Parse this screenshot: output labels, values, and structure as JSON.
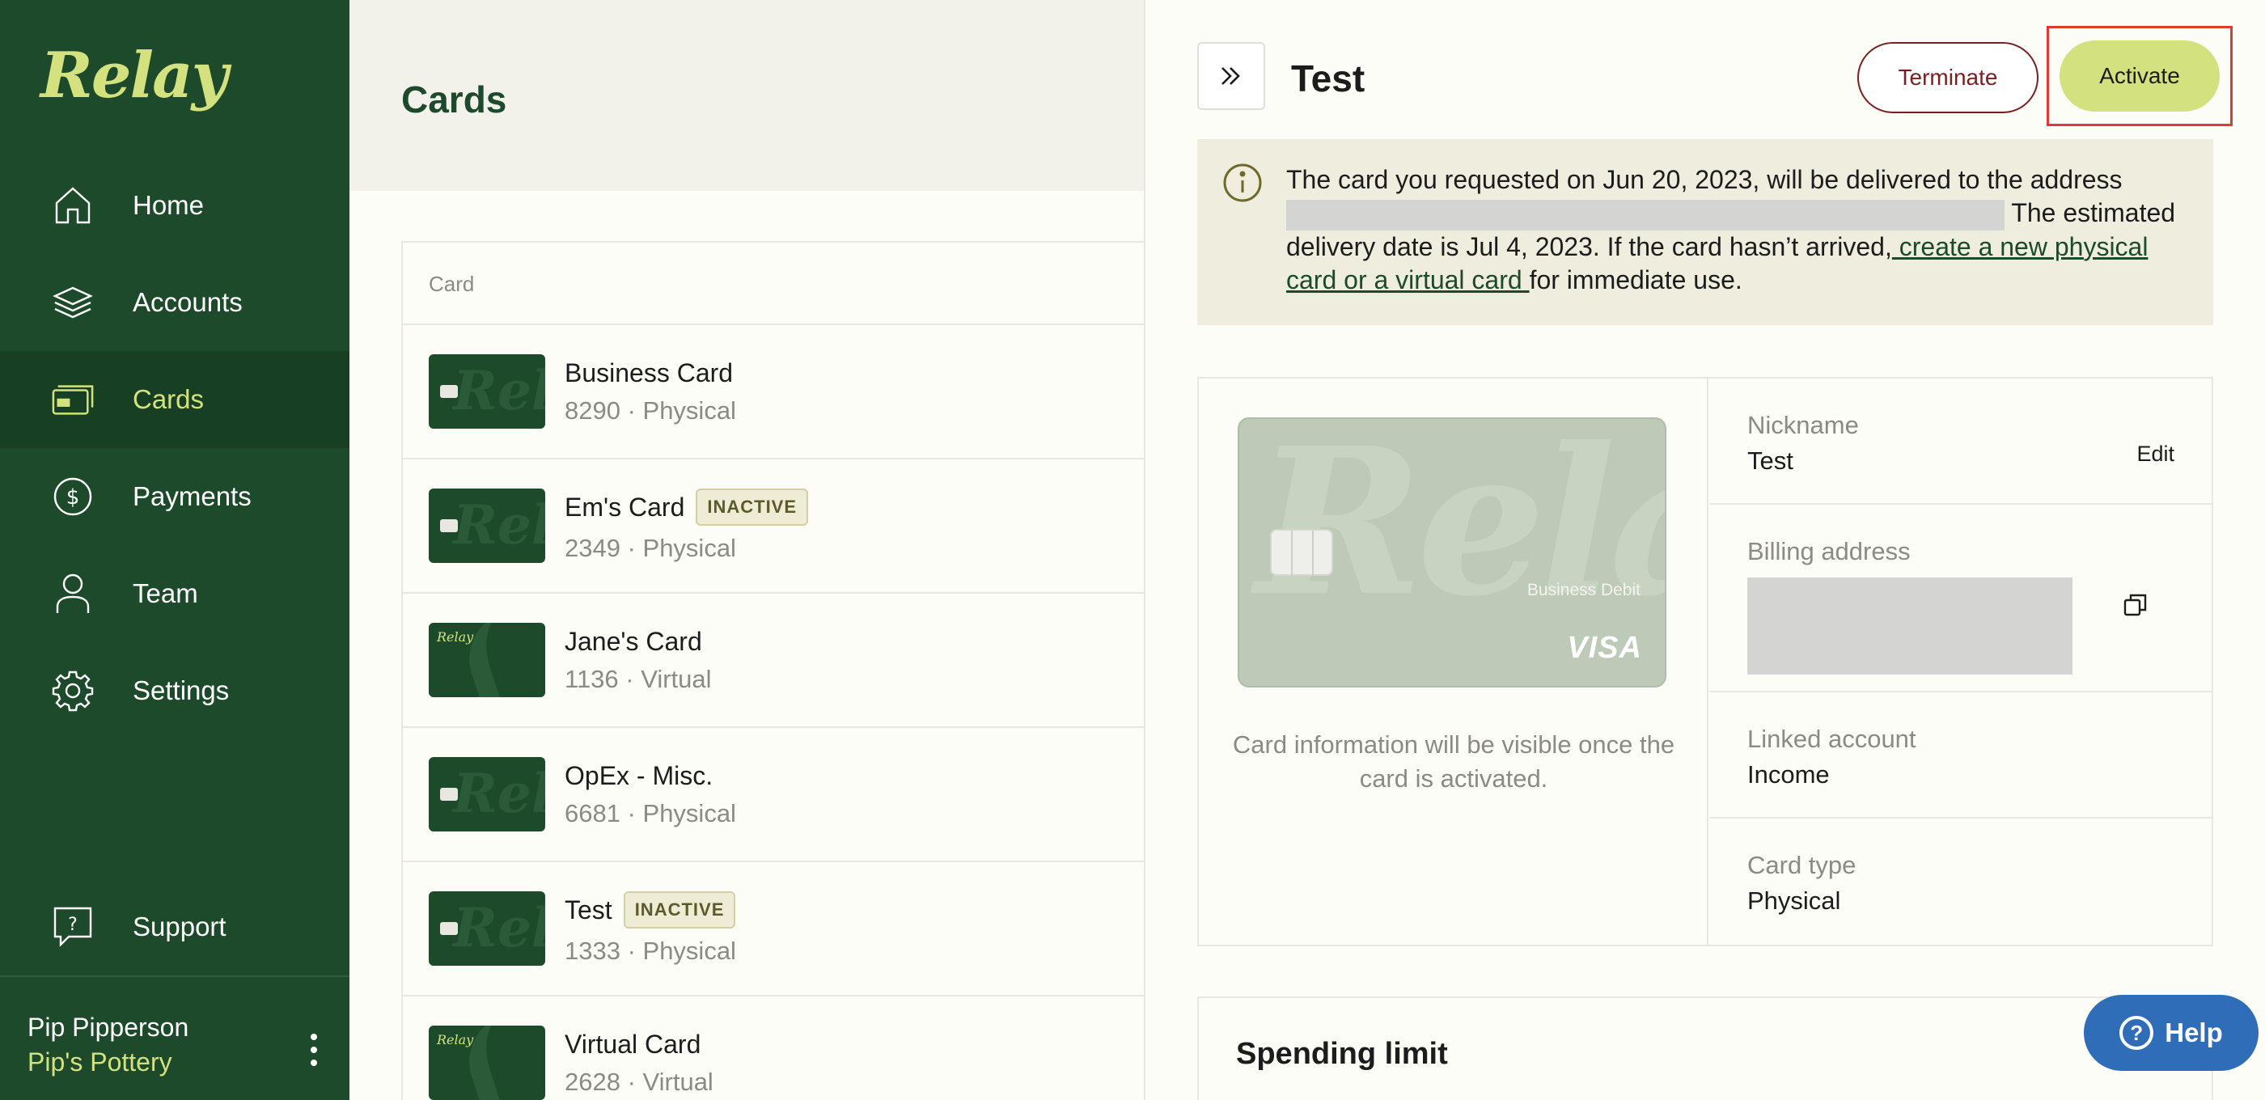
{
  "brand": {
    "logo": "Relay",
    "primary": "#1d4a2b",
    "accent": "#d3e27e"
  },
  "sidebar": {
    "items": [
      {
        "label": "Home",
        "icon": "home-icon"
      },
      {
        "label": "Accounts",
        "icon": "layers-icon"
      },
      {
        "label": "Cards",
        "icon": "card-icon"
      },
      {
        "label": "Payments",
        "icon": "dollar-icon"
      },
      {
        "label": "Team",
        "icon": "person-icon"
      },
      {
        "label": "Settings",
        "icon": "gear-icon"
      }
    ],
    "active": "Cards",
    "support_label": "Support",
    "user_name": "Pip Pipperson",
    "org_name": "Pip's Pottery"
  },
  "cards_list": {
    "title": "Cards",
    "column_header": "Card",
    "rows": [
      {
        "name": "Business Card",
        "sub": "8290 · Physical",
        "badge": ""
      },
      {
        "name": "Em's Card",
        "sub": "2349 · Physical",
        "badge": "INACTIVE"
      },
      {
        "name": "Jane's Card",
        "sub": "1136 · Virtual",
        "badge": ""
      },
      {
        "name": "OpEx - Misc.",
        "sub": "6681 · Physical",
        "badge": ""
      },
      {
        "name": "Test",
        "sub": "1333 · Physical",
        "badge": "INACTIVE"
      },
      {
        "name": "Virtual Card",
        "sub": "2628 · Virtual",
        "badge": ""
      }
    ]
  },
  "detail": {
    "title": "Test",
    "terminate_label": "Terminate",
    "activate_label": "Activate",
    "notice": {
      "text_1": "The card you requested on Jun 20, 2023, will be delivered to the address ",
      "text_2": " The estimated delivery date is Jul 4, 2023. If the card hasn’t arrived,",
      "link": " create a new physical card or a virtual card ",
      "text_3": "for immediate use."
    },
    "card_preview": {
      "logo": "Relay",
      "label": "Business Debit",
      "network": "VISA"
    },
    "card_note": "Card information will be visible once the card is activated.",
    "fields": {
      "nickname_label": "Nickname",
      "nickname_value": "Test",
      "edit_label": "Edit",
      "billing_label": "Billing address",
      "linked_label": "Linked account",
      "linked_value": "Income",
      "type_label": "Card type",
      "type_value": "Physical"
    },
    "spending_title": "Spending limit"
  },
  "help_label": "Help"
}
